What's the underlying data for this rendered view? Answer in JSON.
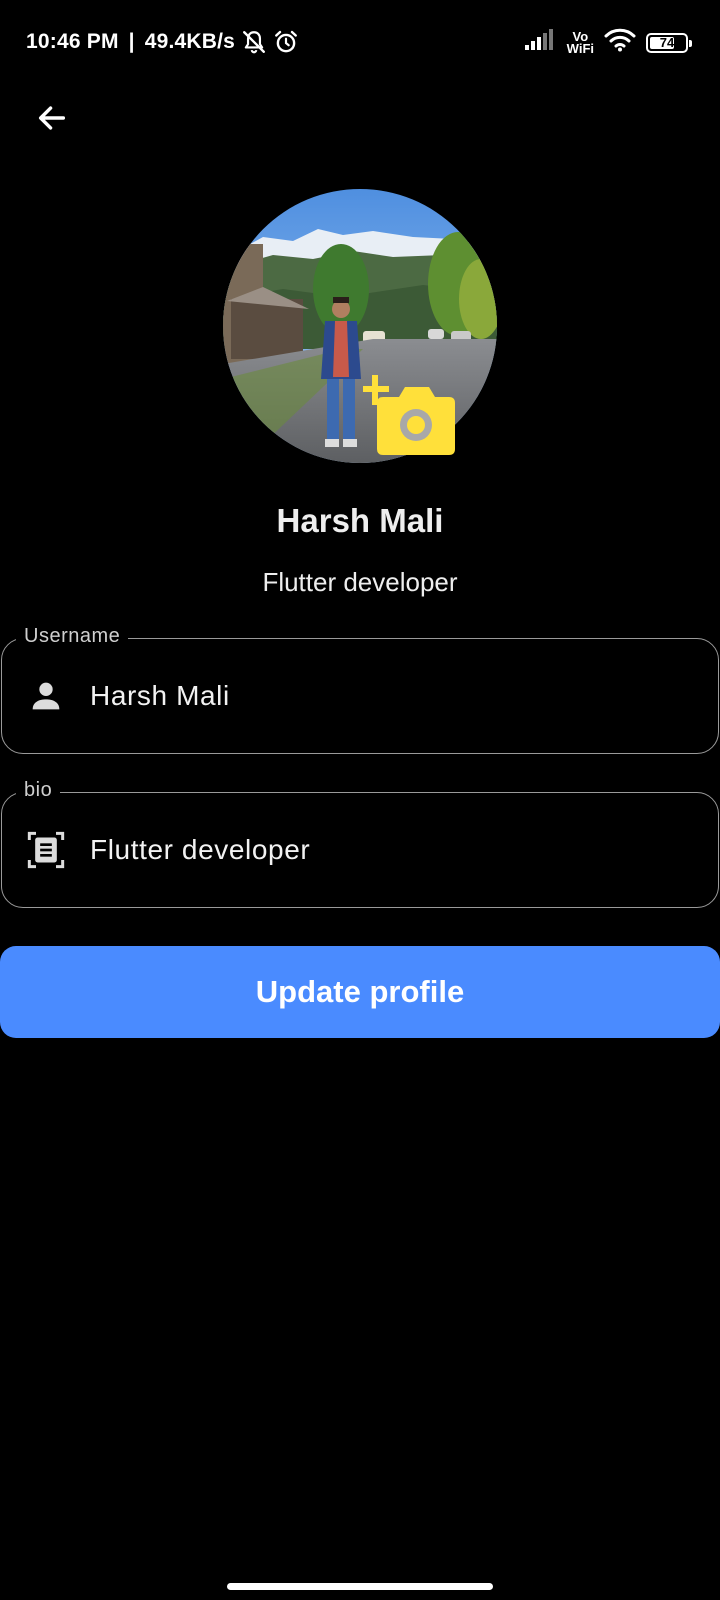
{
  "status_bar": {
    "time": "10:46 PM",
    "separator": "|",
    "network_speed": "49.4KB/s",
    "vowifi_top": "Vo",
    "vowifi_bottom": "WiFi",
    "battery_level": "74",
    "battery_fraction": 0.74,
    "icons": [
      "muted-bell-icon",
      "alarm-icon",
      "signal-icon",
      "wifi-icon",
      "battery-icon"
    ]
  },
  "header": {
    "back_icon": "arrow-left-icon"
  },
  "profile": {
    "name": "Harsh Mali",
    "bio": "Flutter developer",
    "add_photo_icon": "add-a-photo-icon",
    "add_photo_color": "#ffe03a"
  },
  "form": {
    "username": {
      "label": "Username",
      "value": "Harsh Mali",
      "icon": "person-icon"
    },
    "bio": {
      "label": "bio",
      "value": "Flutter developer",
      "icon": "document-scanner-icon"
    }
  },
  "actions": {
    "update_label": "Update profile",
    "update_color": "#4a8bff"
  }
}
